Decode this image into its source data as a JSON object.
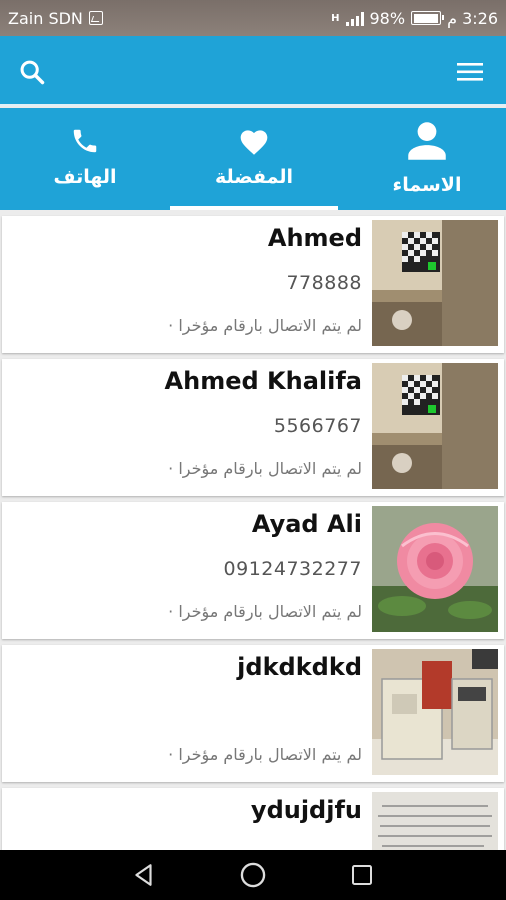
{
  "status_bar": {
    "carrier": "Zain SDN",
    "battery_percent": "98%",
    "time": "3:26 م",
    "network": "H"
  },
  "app_bar": {
    "search_icon": "search-icon",
    "menu_icon": "menu-icon"
  },
  "tabs": [
    {
      "label": "الهاتف",
      "icon": "phone-icon"
    },
    {
      "label": "المفضلة",
      "icon": "heart-icon",
      "selected": true
    },
    {
      "label": "الاسماء",
      "icon": "person-icon"
    }
  ],
  "contacts": [
    {
      "name": "Ahmed",
      "phone": "778888",
      "note": "لم يتم الاتصال بارقام مؤخرا ·"
    },
    {
      "name": "Ahmed Khalifa",
      "phone": "5566767",
      "note": "لم يتم الاتصال بارقام مؤخرا ·"
    },
    {
      "name": "Ayad Ali",
      "phone": "09124732277",
      "note": "لم يتم الاتصال بارقام مؤخرا ·"
    },
    {
      "name": "jdkdkdkd",
      "phone": "",
      "note": "لم يتم الاتصال بارقام مؤخرا ·"
    },
    {
      "name": "ydujdjfu",
      "phone": "",
      "note": ""
    }
  ],
  "colors": {
    "primary": "#1fa3d7",
    "status_bar": "#857a74"
  }
}
